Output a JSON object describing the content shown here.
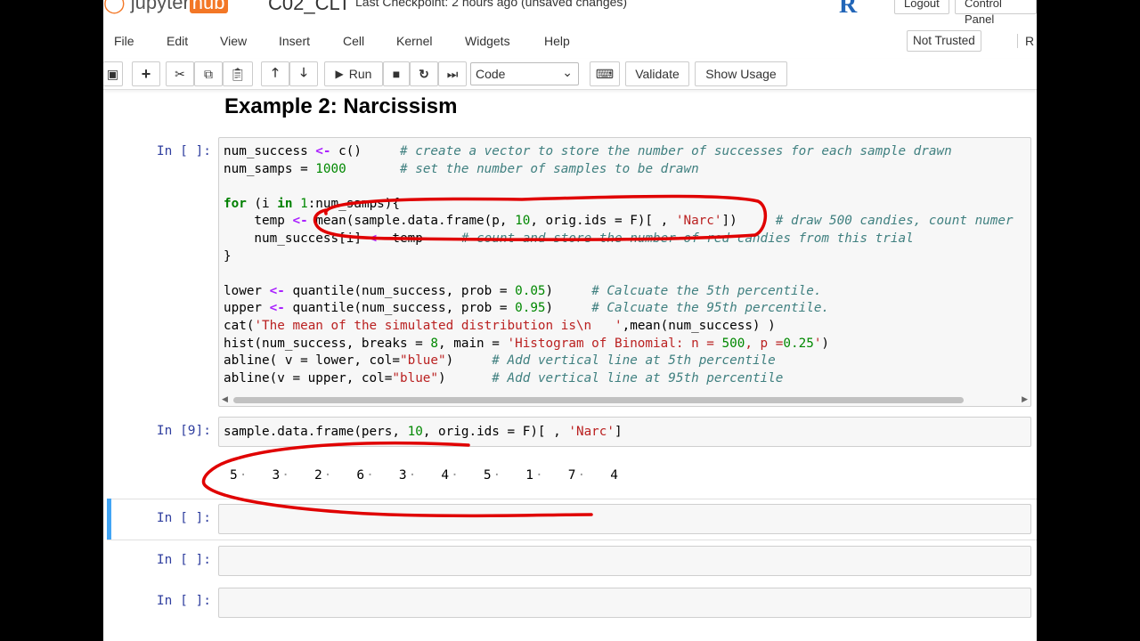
{
  "header": {
    "logo_text": "jupyter",
    "logo_hub": "hub",
    "notebook_name": "C02_CLT",
    "checkpoint": "Last Checkpoint: 2 hours ago  (unsaved changes)",
    "logout": "Logout",
    "control_panel": "Control Panel"
  },
  "menu": [
    "File",
    "Edit",
    "View",
    "Insert",
    "Cell",
    "Kernel",
    "Widgets",
    "Help"
  ],
  "not_trusted": "Not Trusted",
  "kernel_indicator": "R",
  "toolbar": {
    "run_label": "Run",
    "cell_type": "Code",
    "validate_label": "Validate",
    "show_usage_label": "Show Usage"
  },
  "heading": "Example 2: Narcissism",
  "cells": [
    {
      "prompt": "In [ ]:",
      "lines": [
        "num_success <- c()     # create a vector to store the number of successes for each sample drawn",
        "num_samps = 1000       # set the number of samples to be drawn",
        "",
        "for (i in 1:num_samps){",
        "    temp <- mean(sample.data.frame(p, 10, orig.ids = F)[ , 'Narc'])     # draw 500 candies, count numer",
        "    num_success[i] <- temp     # count and store the number of red candies from this trial",
        "}",
        "",
        "lower <- quantile(num_success, prob = 0.05)     # Calcuate the 5th percentile.",
        "upper <- quantile(num_success, prob = 0.95)     # Calcuate the 95th percentile.",
        "cat('The mean of the simulated distribution is\\n   ',mean(num_success) )",
        "hist(num_success, breaks = 8, main = 'Histogram of Binomial: n = 500, p =0.25')",
        "abline( v = lower, col=\"blue\")     # Add vertical line at 5th percentile",
        "abline(v = upper, col=\"blue\")      # Add vertical line at 95th percentile"
      ]
    },
    {
      "prompt": "In [9]:",
      "lines": [
        "sample.data.frame(pers, 10, orig.ids = F)[ , 'Narc']"
      ],
      "output": [
        "5",
        "3",
        "2",
        "6",
        "3",
        "4",
        "5",
        "1",
        "7",
        "4"
      ]
    },
    {
      "prompt": "In [ ]:"
    },
    {
      "prompt": "In [ ]:"
    },
    {
      "prompt": "In [ ]:"
    }
  ],
  "colors": {
    "prompt": "#303f9f",
    "annotation": "#e00000",
    "selected_cell": "#42a5f5"
  }
}
